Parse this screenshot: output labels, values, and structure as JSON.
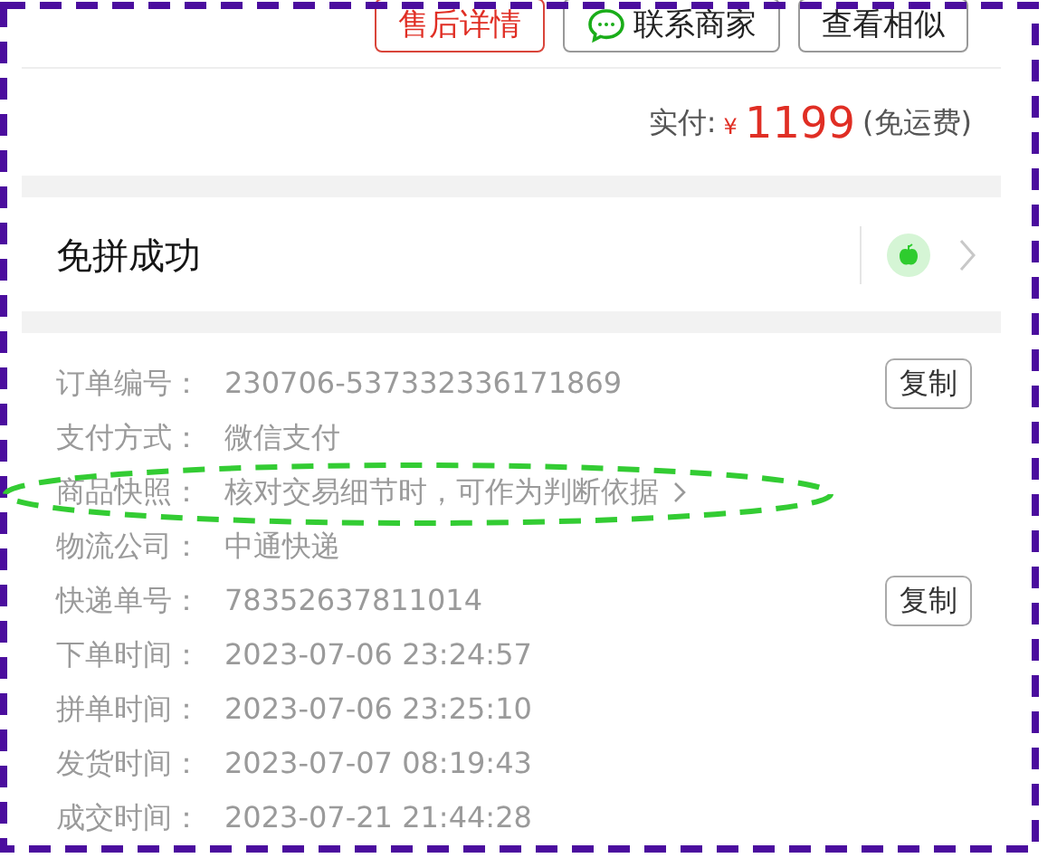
{
  "action_buttons": [
    {
      "label": "售后详情",
      "kind": "primary"
    },
    {
      "label": "联系商家",
      "kind": "chat"
    },
    {
      "label": "查看相似",
      "kind": "plain"
    }
  ],
  "payment": {
    "label": "实付:",
    "currency": "¥",
    "amount": "1199",
    "note": "(免运费)"
  },
  "group_status": {
    "title": "免拼成功"
  },
  "details": [
    {
      "label": "订单编号：",
      "value": "230706-537332336171869",
      "kind": "copy",
      "action": "复制"
    },
    {
      "label": "支付方式：",
      "value": "微信支付",
      "kind": "text"
    },
    {
      "label": "商品快照：",
      "value": "核对交易细节时，可作为判断依据",
      "kind": "link"
    },
    {
      "label": "物流公司：",
      "value": "中通快递",
      "kind": "text"
    },
    {
      "label": "快递单号：",
      "value": "78352637811014",
      "kind": "copy",
      "action": "复制"
    },
    {
      "label": "下单时间：",
      "value": "2023-07-06 23:24:57",
      "kind": "text"
    },
    {
      "label": "拼单时间：",
      "value": "2023-07-06 23:25:10",
      "kind": "text"
    },
    {
      "label": "发货时间：",
      "value": "2023-07-07 08:19:43",
      "kind": "text"
    },
    {
      "label": "成交时间：",
      "value": "2023-07-21 21:44:28",
      "kind": "text"
    }
  ]
}
